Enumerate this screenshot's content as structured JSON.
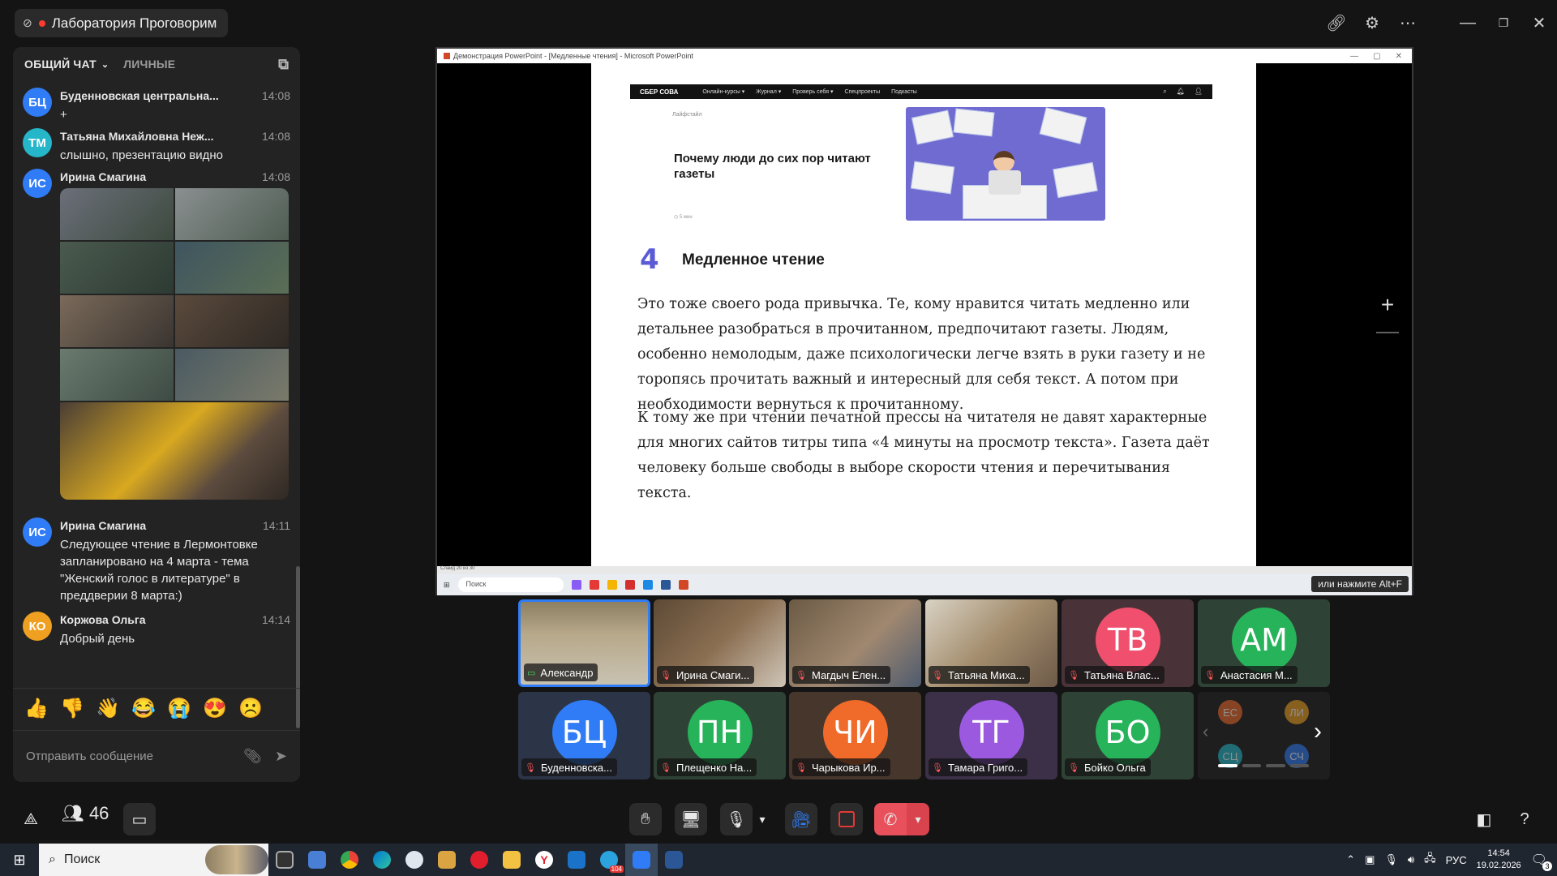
{
  "meeting": {
    "title": "Лаборатория Проговорим"
  },
  "chat": {
    "tabs": [
      "ОБЩИЙ ЧАТ",
      "ЛИЧНЫЕ"
    ],
    "messages": [
      {
        "initials": "БЦ",
        "name": "Буденновская центральна...",
        "time": "14:08",
        "text": "+",
        "color": "#2f7cf6"
      },
      {
        "initials": "ТМ",
        "name": "Татьяна Михайловна Неж...",
        "time": "14:08",
        "text": "слышно, презентацию видно",
        "color": "#25b7c9"
      },
      {
        "initials": "ИС",
        "name": "Ирина Смагина",
        "time": "14:08",
        "text": "",
        "color": "#2f7cf6"
      },
      {
        "initials": "ИС",
        "name": "Ирина Смагина",
        "time": "14:11",
        "text": "Следующее чтение в Лермонтовке запланировано на 4 марта - тема \"Женский голос в литературе\" в преддверии 8 марта:)",
        "color": "#2f7cf6"
      },
      {
        "initials": "КО",
        "name": "Коржова Ольга",
        "time": "14:14",
        "text": "Добрый день",
        "color": "#f0a020"
      }
    ],
    "reactions": [
      "👍",
      "👎",
      "👋",
      "😂",
      "😭",
      "😍",
      "☹️"
    ],
    "compose_placeholder": "Отправить сообщение"
  },
  "presentation": {
    "window_title": "Демонстрация PowerPoint - [Медленные чтения] - Microsoft PowerPoint",
    "site": {
      "logo": "СБЕР СОВА",
      "nav": [
        "Онлайн-курсы ▾",
        "Журнал ▾",
        "Проверь себя ▾",
        "Спецпроекты",
        "Подкасты"
      ]
    },
    "card_tag": "Лайфстайл",
    "card_title": "Почему люди до сих пор читают газеты",
    "card_meta": "◷ 5 мин",
    "section_number": "4",
    "section_heading": "Медленное чтение",
    "paragraph1": "Это тоже своего рода привычка. Те, кому нравится читать медленно или детальнее разобраться в прочитанном, предпочитают газеты. Людям, особенно немолодым, даже психологически легче взять в руки газету и не торопясь прочитать важный и интересный для себя текст. А потом при необходимости вернуться к прочитанному.",
    "paragraph2": "К тому же при чтении печатной прессы на читателя не давят характерные для многих сайтов титры типа «4 минуты на просмотр текста». Газета даёт человеку больше свободы в выборе скорости чтения и перечитывания текста.",
    "slide_status": "Слайд 20 из 30",
    "taskbar_search": "Поиск",
    "alt_hint": "или нажмите Alt+F"
  },
  "participants": {
    "video": [
      {
        "name": "Александр",
        "presenting": true
      },
      {
        "name": "Ирина Смаги..."
      },
      {
        "name": "Магдыч Елен..."
      },
      {
        "name": "Татьяна Миха..."
      }
    ],
    "avatars": [
      {
        "initials": "ТВ",
        "name": "Татьяна Влас...",
        "color": "#f0506e"
      },
      {
        "initials": "АМ",
        "name": "Анастасия М...",
        "color": "#27b35a"
      },
      {
        "initials": "БЦ",
        "name": "Буденновска...",
        "color": "#2f7cf6"
      },
      {
        "initials": "ПН",
        "name": "Плещенко На...",
        "color": "#27b35a"
      },
      {
        "initials": "ЧИ",
        "name": "Чарыкова Ир...",
        "color": "#f06a2a"
      },
      {
        "initials": "ТГ",
        "name": "Тамара Григо...",
        "color": "#9b59e0"
      },
      {
        "initials": "БО",
        "name": "Бойко Ольга",
        "color": "#27b35a"
      }
    ],
    "more": [
      {
        "initials": "ЕС",
        "color": "#f06a2a"
      },
      {
        "initials": "ЛИ",
        "color": "#f0a020"
      },
      {
        "initials": "СЦ",
        "color": "#25b7c9"
      },
      {
        "initials": "СЧ",
        "color": "#2f7cf6"
      }
    ]
  },
  "controls": {
    "participants_count": "46"
  },
  "taskbar": {
    "search": "Поиск",
    "language": "РУС",
    "time": "14:54",
    "date": "19.02.2026",
    "notifications": "3",
    "badge": "104"
  }
}
